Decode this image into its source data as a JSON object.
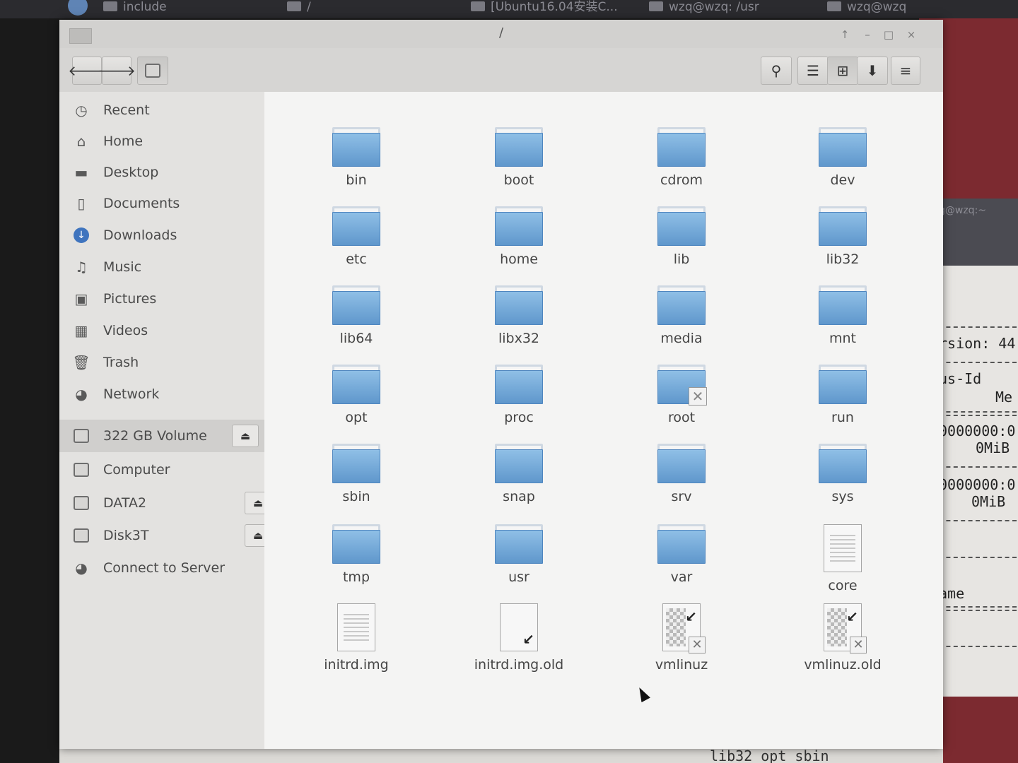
{
  "taskbar": {
    "items": [
      "include",
      "/",
      "[Ubuntu16.04安装C...",
      "wzq@wzq: /usr",
      "wzq@wzq"
    ]
  },
  "window": {
    "title": "/",
    "controls": [
      "↑",
      "–",
      "□",
      "×"
    ]
  },
  "toolbar": {
    "back_icon": "left-arrow-icon",
    "forward_icon": "right-arrow-icon",
    "location_icon": "drive-icon",
    "search_icon": "search-icon",
    "list_view_icon": "list-icon",
    "grid_view_icon": "grid-icon",
    "sort_icon": "down-arrow-icon",
    "menu_icon": "hamburger-menu-icon"
  },
  "sidebar": {
    "places": [
      {
        "label": "Recent",
        "icon": "clock-icon"
      },
      {
        "label": "Home",
        "icon": "home-icon"
      },
      {
        "label": "Desktop",
        "icon": "desktop-icon"
      },
      {
        "label": "Documents",
        "icon": "document-icon"
      },
      {
        "label": "Downloads",
        "icon": "download-icon"
      },
      {
        "label": "Music",
        "icon": "music-icon"
      },
      {
        "label": "Pictures",
        "icon": "pictures-icon"
      },
      {
        "label": "Videos",
        "icon": "video-icon"
      },
      {
        "label": "Trash",
        "icon": "trash-icon"
      },
      {
        "label": "Network",
        "icon": "network-icon"
      }
    ],
    "devices": [
      {
        "label": "322 GB Volume",
        "eject": true
      },
      {
        "label": "Computer",
        "eject": false
      },
      {
        "label": "DATA2",
        "eject": true
      },
      {
        "label": "Disk3T",
        "eject": true
      }
    ],
    "connect_label": "Connect to Server"
  },
  "files": [
    {
      "name": "bin",
      "kind": "folder"
    },
    {
      "name": "boot",
      "kind": "folder"
    },
    {
      "name": "cdrom",
      "kind": "folder"
    },
    {
      "name": "dev",
      "kind": "folder"
    },
    {
      "name": "etc",
      "kind": "folder"
    },
    {
      "name": "home",
      "kind": "folder"
    },
    {
      "name": "lib",
      "kind": "folder"
    },
    {
      "name": "lib32",
      "kind": "folder"
    },
    {
      "name": "lib64",
      "kind": "folder"
    },
    {
      "name": "libx32",
      "kind": "folder"
    },
    {
      "name": "media",
      "kind": "folder"
    },
    {
      "name": "mnt",
      "kind": "folder"
    },
    {
      "name": "opt",
      "kind": "folder"
    },
    {
      "name": "proc",
      "kind": "folder"
    },
    {
      "name": "root",
      "kind": "folder-locked"
    },
    {
      "name": "run",
      "kind": "folder"
    },
    {
      "name": "sbin",
      "kind": "folder"
    },
    {
      "name": "snap",
      "kind": "folder"
    },
    {
      "name": "srv",
      "kind": "folder"
    },
    {
      "name": "sys",
      "kind": "folder"
    },
    {
      "name": "tmp",
      "kind": "folder"
    },
    {
      "name": "usr",
      "kind": "folder"
    },
    {
      "name": "var",
      "kind": "folder"
    },
    {
      "name": "core",
      "kind": "text"
    },
    {
      "name": "initrd.img",
      "kind": "text"
    },
    {
      "name": "initrd.img.old",
      "kind": "link"
    },
    {
      "name": "vmlinuz",
      "kind": "link-locked"
    },
    {
      "name": "vmlinuz.old",
      "kind": "link-locked"
    }
  ],
  "background_terminal": {
    "user": "g@wzq:~",
    "lines": [
      "rsion: 44",
      "us-Id",
      "Me",
      "0000000:0",
      "0MiB",
      "0000000:0",
      "0MiB",
      "ame"
    ],
    "bottom_text": "lib32   opt   sbin"
  }
}
